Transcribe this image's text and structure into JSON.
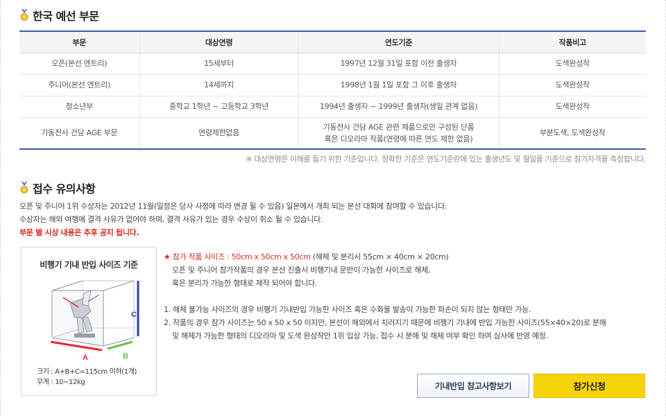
{
  "section1": {
    "title": "한국 예선 부문",
    "headers": [
      "부문",
      "대상연령",
      "연도기준",
      "작품비고"
    ],
    "rows": [
      [
        "오픈(본선 엔트리)",
        "15세부터",
        "1997년 12월 31일 포함 이전 출생자",
        "도색완성작"
      ],
      [
        "주니어(본선 엔트리)",
        "14세까지",
        "1998년 1월 1일 포함 그 이후 출생자",
        "도색완성작"
      ],
      [
        "청소년부",
        "중학교 1학년 ~ 고등학교 3학년",
        "1994년 출생자 ~ 1999년 출생자(생일 관계 없음)",
        "도색완성작"
      ],
      [
        "기동전사 건담 AGE 부문",
        "연령제한없음",
        "기동전사 건담 AGE 관련 제품으로만 구성된 단품|혹은 디오라마 작품(연령에 따른 연도 제한 없음)",
        "부분도색, 도색완성작"
      ]
    ],
    "note": "※ 대상연령은 이해를 돕기 위한 기준입니다. 정확한 기준은 연도기준란에 있는 출생년도 및 월일을 기준으로 참가자격을 측정합니다."
  },
  "section2": {
    "title": "접수 유의사항",
    "line1": "오픈 및 주니어 1위 수상자는 2012년 11월(일정은 당사 사정에 따라 변경 될 수 있음) 일본에서 개최 되는 본선 대회에 참여할 수 있습니다.",
    "line2": "수상자는 해외 여행에 결격 사유가 없어야 하며, 결격 사유가 있는 경우 수상이 취소 될 수 있습니다.",
    "line3": "부문 별 시상 내용은 추후 공지 됩니다."
  },
  "box": {
    "title": "비행기 기내 반입 사이즈 기준",
    "label_a": "A",
    "label_b": "B",
    "label_c": "C",
    "size": "크기 : A+B+C=115cm 이하(1개)",
    "weight": "무게 : 10~12kg",
    "colors": {
      "a": "#e8262d",
      "b": "#6cc04a",
      "c": "#2a3fa8"
    }
  },
  "rules": {
    "star": "★",
    "size_label": "참가 작품 사이즈 : 50cm x 50cm x 50cm",
    "size_paren": " (해체 및 분리시 55cm × 40cm × 20cm)",
    "size_desc1": "오픈 및 주니어 참가작품의 경우 본선 진출시 비행기내 운반이 가능한 사이즈로 해체,",
    "size_desc2": "혹은 분리가 가능한 형태로 제작 되어야 합니다.",
    "item1": "1. 해체 불가능 사이즈의 경우 비행기 기내반입 가능한 사이즈 혹은 수화물 발송이 가능한 파손이 되지 않는 형태만 가능.",
    "item2a": "2. 작품의 경우 참가 사이즈는 50 x 50 x 50 이지만, 본선이 해외에서 치러지기 때문에 비행기 기내에 반입 가능한 사이즈(55×40×20)로 분해",
    "item2b": "및 해체가 가능한 형태의 디오라마 및 도색 완성작만 1위 입상 가능, 접수 시 분해 및 해체 여부 확인 하여 심사에 반영 예정."
  },
  "buttons": {
    "reference": "기내반입 참고사항보기",
    "apply": "참가신청"
  },
  "colors": {
    "accent": "#3d5aa8",
    "notice_red": "#d9261c",
    "apply_yellow": "#f7d309"
  }
}
